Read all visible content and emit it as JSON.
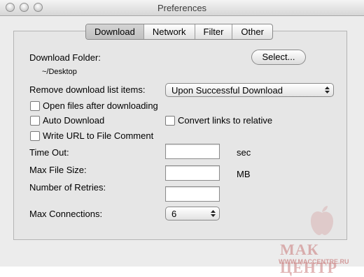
{
  "window": {
    "title": "Preferences"
  },
  "tabs": [
    "Download",
    "Network",
    "Filter",
    "Other"
  ],
  "download": {
    "folder_label": "Download Folder:",
    "folder_path": "~/Desktop",
    "select_button": "Select...",
    "remove_label": "Remove download list items:",
    "remove_value": "Upon Successful Download",
    "open_files_label": "Open files after downloading",
    "auto_download_label": "Auto Download",
    "convert_links_label": "Convert links to relative",
    "write_url_label": "Write URL to File Comment",
    "timeout_label": "Time Out:",
    "timeout_value": "",
    "timeout_unit": "sec",
    "max_size_label": "Max File Size:",
    "max_size_value": "",
    "max_size_unit": "MB",
    "retries_label": "Number of Retries:",
    "retries_value": "",
    "connections_label": "Max Connections:",
    "connections_value": "6"
  },
  "watermark": {
    "text": "МАК ЦЕНТР",
    "url": "WWW.MACCENTRE.RU"
  }
}
